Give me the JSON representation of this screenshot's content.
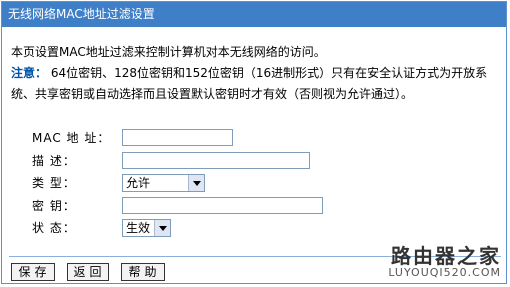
{
  "title": "无线网络MAC地址过滤设置",
  "intro": {
    "line1": "本页设置MAC地址过滤来控制计算机对本无线网络的访问。",
    "warn_label": "注意：",
    "warn_text": " 64位密钥、128位密钥和152位密钥（16进制形式）只有在安全认证方式为开放系统、共享密钥或自动选择而且设置默认密钥时才有效（否则视为允许通过）。"
  },
  "form": {
    "mac_label": "MAC 地 址：",
    "mac_value": "",
    "desc_label": "描    述：",
    "desc_value": "",
    "type_label": "类    型：",
    "type_value": "允许",
    "key_label": "密    钥：",
    "key_value": "",
    "status_label": "状    态：",
    "status_value": "生效"
  },
  "buttons": {
    "save": "保存",
    "back": "返回",
    "help": "帮助"
  },
  "watermark": {
    "cn": "路由器之家",
    "en": "LUYOUQI520.COM"
  },
  "colors": {
    "title_bar": "#3f7fc8",
    "warn_label": "#0055aa"
  }
}
